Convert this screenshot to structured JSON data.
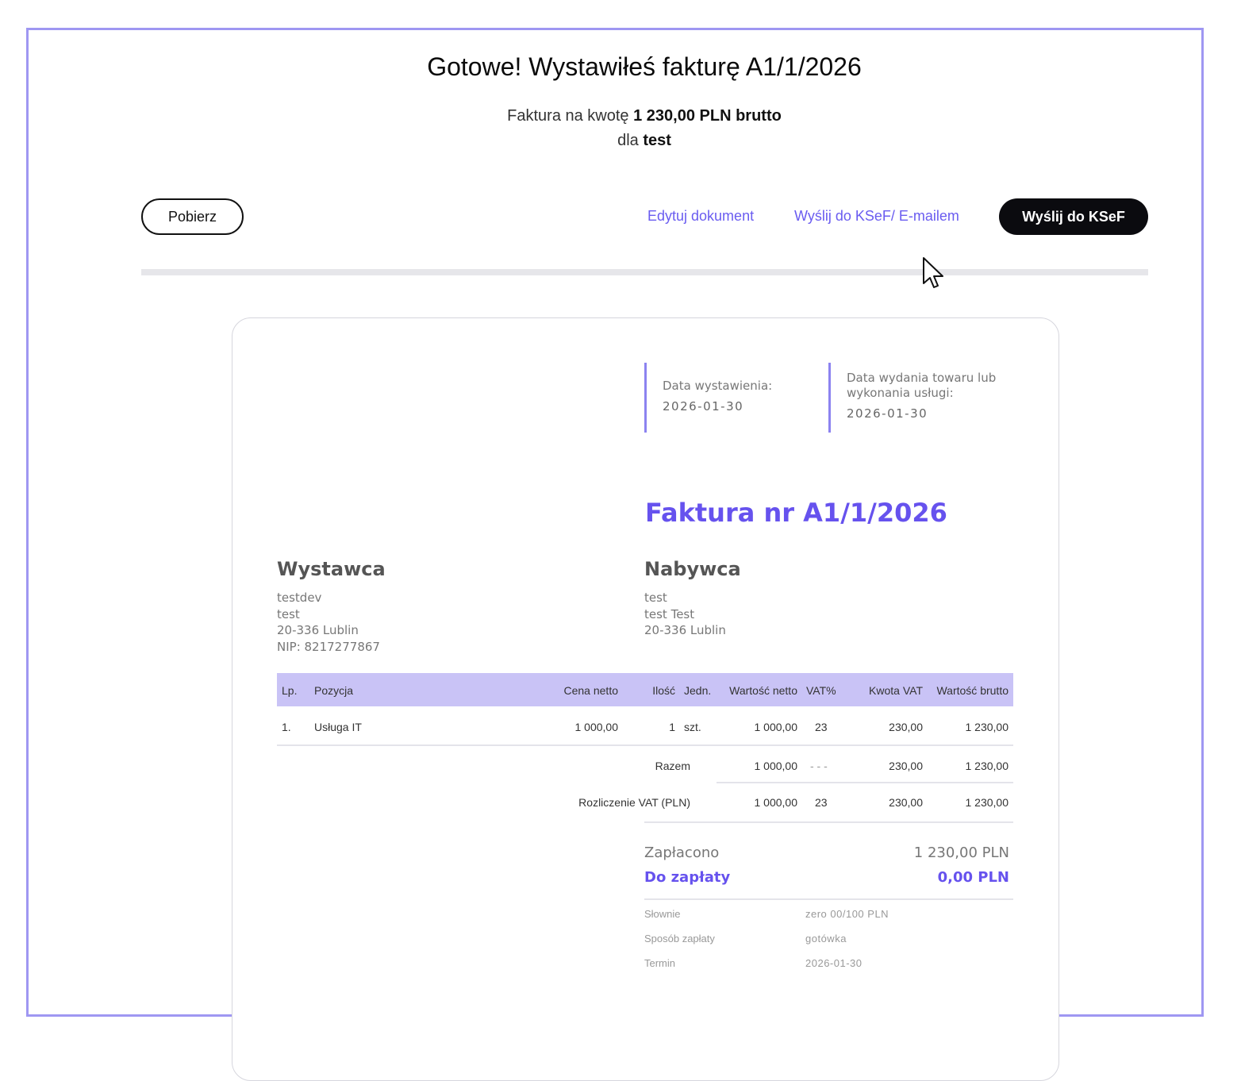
{
  "header": {
    "title": "Gotowe! Wystawiłeś fakturę A1/1/2026",
    "amount_prefix": "Faktura na kwotę",
    "amount": "1 230,00 PLN brutto",
    "client_prefix": "dla",
    "client": "test"
  },
  "actions": {
    "download": "Pobierz",
    "edit": "Edytuj dokument",
    "send_email": "Wyślij do KSeF/ E-mailem",
    "send_ksef": "Wyślij do KSeF"
  },
  "invoice": {
    "issue_date_label": "Data wystawienia:",
    "issue_date": "2026-01-30",
    "delivery_date_label": "Data wydania towaru lub wykonania usługi:",
    "delivery_date": "2026-01-30",
    "title": "Faktura nr A1/1/2026",
    "seller": {
      "heading": "Wystawca",
      "lines": [
        "testdev",
        "test",
        "20-336 Lublin",
        "NIP: 8217277867"
      ]
    },
    "buyer": {
      "heading": "Nabywca",
      "lines": [
        "test",
        "test Test",
        "20-336 Lublin"
      ]
    },
    "table": {
      "headers": [
        "Lp.",
        "Pozycja",
        "Cena netto",
        "Ilość",
        "Jedn.",
        "Wartość netto",
        "VAT%",
        "Kwota VAT",
        "Wartość brutto"
      ],
      "rows": [
        [
          "1.",
          "Usługa IT",
          "1 000,00",
          "1",
          "szt.",
          "1 000,00",
          "23",
          "230,00",
          "1 230,00"
        ]
      ]
    },
    "totals": {
      "label": "Razem",
      "net": "1 000,00",
      "vat_rate": "- - -",
      "vat": "230,00",
      "gross": "1 230,00"
    },
    "vat_settlement": {
      "label": "Rozliczenie VAT (PLN)",
      "net": "1 000,00",
      "vat_rate": "23",
      "vat": "230,00",
      "gross": "1 230,00"
    },
    "payment": {
      "paid_label": "Zapłacono",
      "paid_value": "1 230,00 PLN",
      "due_label": "Do zapłaty",
      "due_value": "0,00 PLN",
      "words_label": "Słownie",
      "words_value": "zero 00/100 PLN",
      "method_label": "Sposób zapłaty",
      "method_value": "gotówka",
      "term_label": "Termin",
      "term_value": "2026-01-30"
    }
  },
  "colors": {
    "accent": "#6652ee",
    "frame": "#9f97f2",
    "table_header": "#c9c3f6",
    "dark_button": "#0b0b0f"
  },
  "icons": {
    "cursor": "mouse-pointer-icon"
  }
}
